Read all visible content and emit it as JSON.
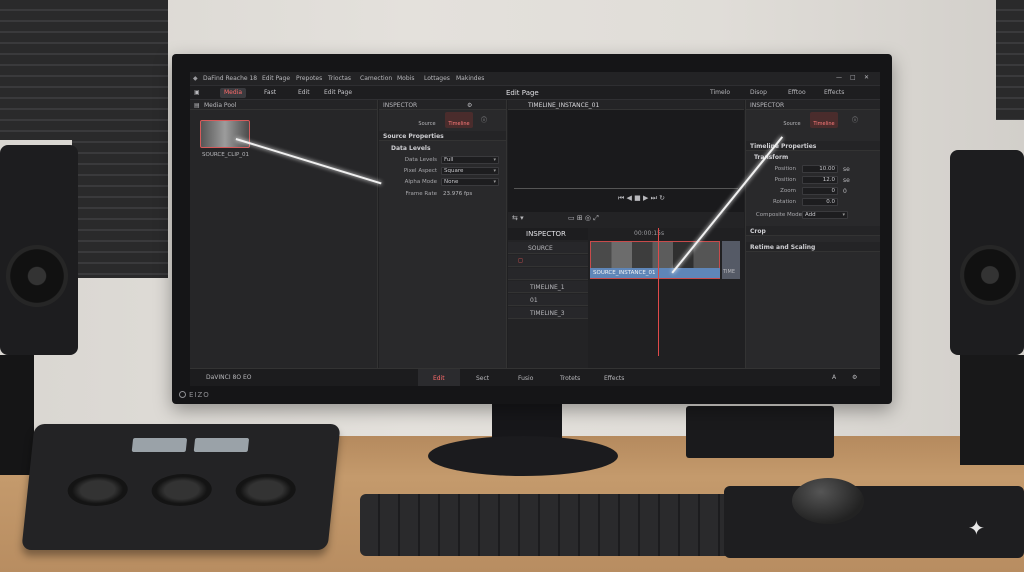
{
  "app": {
    "title": "DaFind Reache 18",
    "menu": [
      "Edit Page",
      "Prepotes",
      "Trioctas",
      "Camection",
      "Mobis",
      "Lottages",
      "Makindes"
    ],
    "page_title": "Edit Page"
  },
  "page_tabs": [
    {
      "label": "Media",
      "active": true
    },
    {
      "label": "Fast",
      "active": false
    },
    {
      "label": "Edit",
      "active": false
    },
    {
      "label": "Edit Page",
      "active": false
    }
  ],
  "page_tabs_right": [
    "Timelo",
    "Disop",
    "Efftoo",
    "Effects"
  ],
  "media_pool": {
    "title": "Media Pool",
    "clip_name": "SOURCE_CLIP_01"
  },
  "inspector": {
    "title": "INSPECTOR",
    "tabs": [
      "Source",
      "Timeline"
    ],
    "section": "Source Properties",
    "group": "Data Levels",
    "rows": [
      {
        "label": "Data Levels",
        "value": "Full"
      },
      {
        "label": "Pixel Aspect",
        "value": "Square"
      },
      {
        "label": "Alpha Mode",
        "value": "None"
      },
      {
        "label": "Frame Rate",
        "value": "23.976 fps"
      }
    ]
  },
  "viewer": {
    "timeline_name": "TIMELINE_INSTANCE_01"
  },
  "timeline": {
    "panel_label": "INSPECTOR",
    "track_source": "SOURCE",
    "tracks": [
      "TIMELINE_1",
      "01",
      "TIMELINE_3"
    ],
    "timecode": "00:00:15s",
    "clip_label": "SOURCE_INSTANCE_01",
    "clip2_label": "TIME"
  },
  "right_inspector": {
    "title": "INSPECTOR",
    "tabs": [
      "Source",
      "Timeline"
    ],
    "section": "Timeline Properties",
    "group": "Transform",
    "rows": [
      {
        "label": "Position",
        "value": "10.00",
        "unit": "se"
      },
      {
        "label": "Position",
        "value": "12.0",
        "unit": "se"
      },
      {
        "label": "Zoom",
        "value": "0",
        "unit": "0"
      },
      {
        "label": "Rotation",
        "value": "0.0",
        "unit": ""
      }
    ],
    "composite_label": "Composite Mode",
    "composite_value": "Add",
    "crop": "Crop",
    "retime": "Retime and Scaling"
  },
  "footer": {
    "version": "DaVINCI 8O EO",
    "tabs": [
      {
        "label": "Edit",
        "active": true
      },
      {
        "label": "Sect",
        "active": false
      },
      {
        "label": "Fusio",
        "active": false
      },
      {
        "label": "Trotets",
        "active": false
      },
      {
        "label": "Effects",
        "active": false
      }
    ]
  },
  "monitor": {
    "brand": "EIZO"
  },
  "colors": {
    "accent": "#e05555",
    "clip_blue": "#5f86b8"
  }
}
